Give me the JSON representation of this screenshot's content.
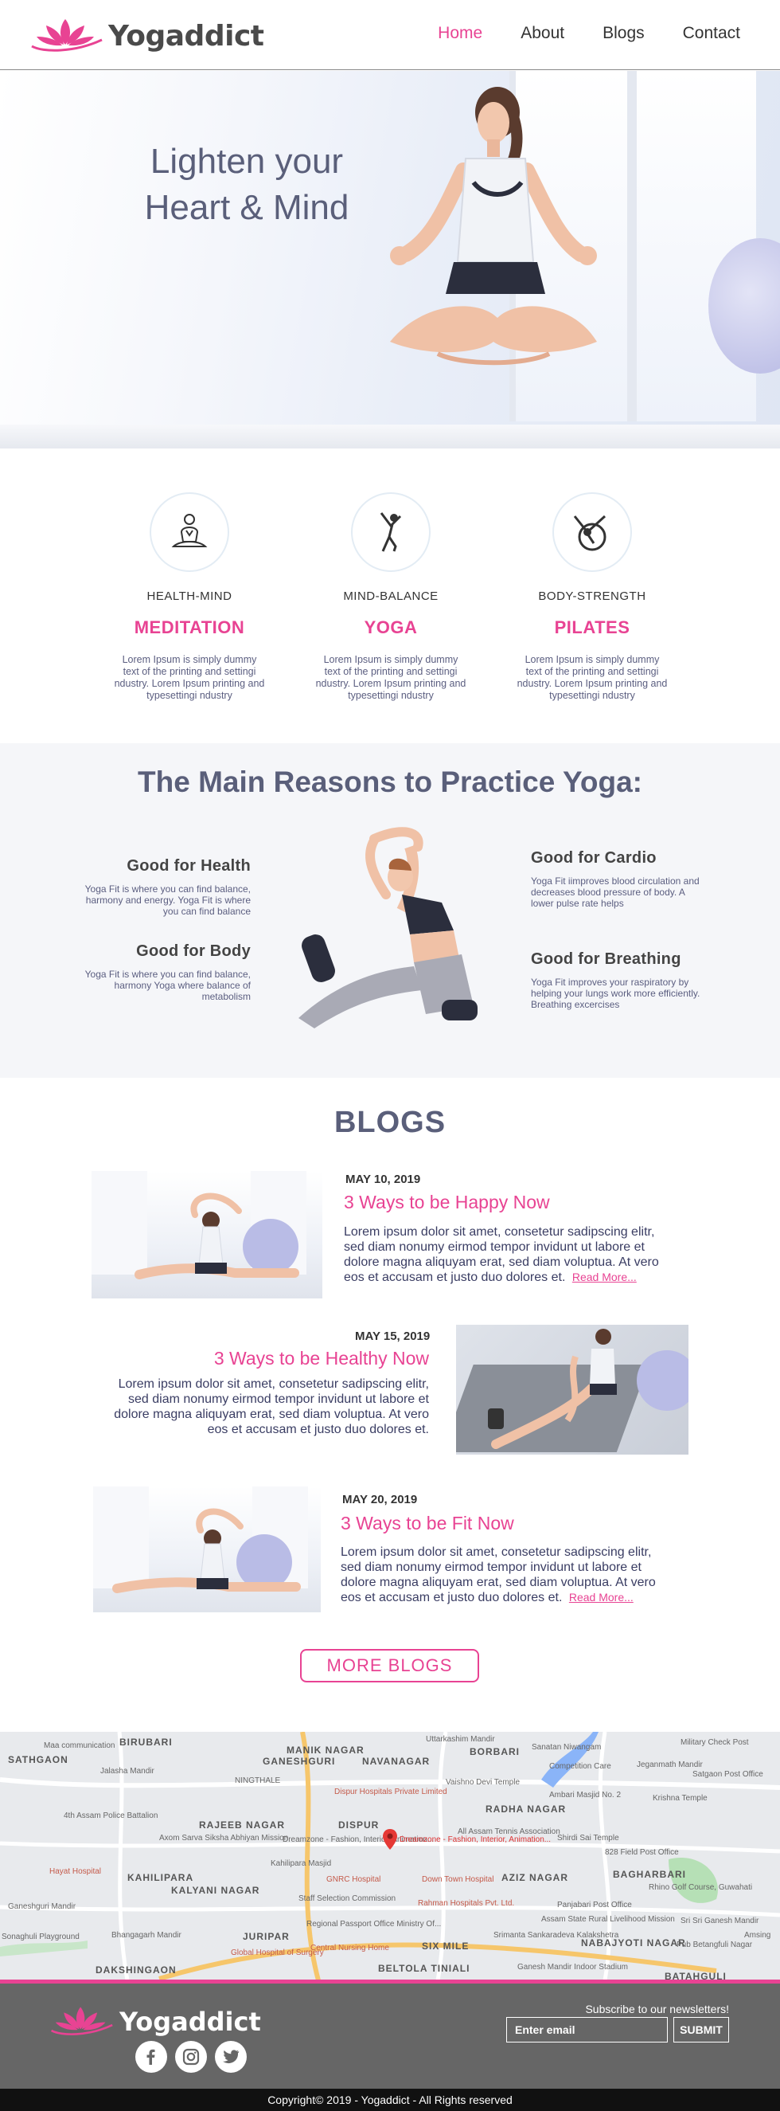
{
  "brand": {
    "name": "Yogaddict",
    "accent": "#e84393"
  },
  "nav": {
    "items": [
      "Home",
      "About",
      "Blogs",
      "Contact"
    ],
    "active": "Home"
  },
  "hero": {
    "line1": "Lighten your",
    "line2": "Heart & Mind"
  },
  "features": [
    {
      "icon": "meditation-icon",
      "sub": "HEALTH-MIND",
      "title": "MEDITATION",
      "desc": "Lorem Ipsum is simply dummy text of the printing and settingi ndustry. Lorem Ipsum printing and typesettingi ndustry"
    },
    {
      "icon": "yoga-pose-icon",
      "sub": "MIND-BALANCE",
      "title": "YOGA",
      "desc": "Lorem Ipsum is simply dummy text of the printing and settingi ndustry. Lorem Ipsum printing and typesettingi ndustry"
    },
    {
      "icon": "pilates-ring-icon",
      "sub": "BODY-STRENGTH",
      "title": "PILATES",
      "desc": "Lorem Ipsum is simply dummy text of the printing and settingi ndustry. Lorem Ipsum printing and typesettingi ndustry"
    }
  ],
  "reasons": {
    "title": "The Main Reasons to Practice Yoga:",
    "items": [
      {
        "heading": "Good for Health",
        "text": "Yoga Fit is where you can find balance, harmony and energy. Yoga Fit is where you can find balance"
      },
      {
        "heading": "Good for Body",
        "text": "Yoga Fit is where you can find balance, harmony Yoga where balance of metabolism"
      },
      {
        "heading": "Good for Cardio",
        "text": "Yoga Fit iimproves blood circulation and decreases blood pressure of body. A lower pulse rate helps"
      },
      {
        "heading": "Good for Breathing",
        "text": "Yoga Fit improves your raspiratory by helping your lungs work more efficiently. Breathing excercises"
      }
    ]
  },
  "blogs": {
    "title": "BLOGS",
    "posts": [
      {
        "date": "MAY 10, 2019",
        "title": "3 Ways to be Happy Now",
        "body": "Lorem ipsum dolor sit amet, consetetur sadipscing elitr, sed diam nonumy eirmod tempor invidunt ut labore et dolore magna aliquyam erat, sed diam voluptua. At vero eos et accusam et justo duo dolores et.",
        "more": "Read More..."
      },
      {
        "date": "MAY 15, 2019",
        "title": "3 Ways to be Healthy Now",
        "body": "Lorem ipsum dolor sit amet, consetetur sadipscing elitr, sed diam nonumy eirmod tempor invidunt ut labore et dolore magna aliquyam erat, sed diam voluptua. At vero eos et accusam et justo duo dolores et."
      },
      {
        "date": "MAY 20, 2019",
        "title": "3 Ways to be Fit Now",
        "body": "Lorem ipsum dolor sit amet, consetetur sadipscing elitr, sed diam nonumy eirmod tempor invidunt ut labore et dolore magna aliquyam erat, sed diam voluptua. At vero eos et accusam et justo duo dolores et.",
        "more": "Read More..."
      }
    ],
    "more_button": "MORE BLOGS"
  },
  "map": {
    "areas": [
      "BIRUBARI",
      "SATHGAON",
      "GANESHGURI",
      "NAVANAGAR",
      "BORBARI",
      "RAJEEB NAGAR",
      "DISPUR",
      "KAHILIPARA",
      "KALYANI NAGAR",
      "RADHA NAGAR",
      "AZIZ NAGAR",
      "BAGHARBARI",
      "JURIPAR",
      "SIX MILE",
      "NABAJYOTI NAGAR",
      "DAKSHINGAON",
      "BELTOLA TINIALI",
      "BATAHGULI",
      "MANIK NAGAR",
      "NINGTHALE"
    ],
    "pois": [
      "Maa communication",
      "Jalasha Mandir",
      "Uttarkashim Mandir",
      "Sanatan Niwangam",
      "Military Check Post",
      "Competition Care",
      "Jeganmath Mandir",
      "Satgaon Post Office",
      "Dispur Hospitals Private Limited",
      "Vaishno Devi Temple",
      "All Assam Tennis Association",
      "Ambari Masjid No. 2",
      "Krishna Temple",
      "4th Assam Police Battalion",
      "Dreamzone - Fashion, Interior, Animation...",
      "Shirdi Sai Temple",
      "Axom Sarva Siksha Abhiyan Mission",
      "Kahilipara Masjid",
      "828 Field Post Office",
      "Hayat Hospital",
      "GNRC Hospital",
      "Down Town Hospital",
      "Rhino Golf Course, Guwahati",
      "Staff Selection Commission",
      "Rahman Hospitals Pvt. Ltd.",
      "Panjabari Post Office",
      "Sonaghuli Playground",
      "Regional Passport Office Ministry Of...",
      "Central Nursing Home",
      "Srimanta Sankaradeva Kalakshetra",
      "Assam State Rural Livelihood Mission",
      "Global Hospital of Surgery",
      "Ganesh Mandir Indoor Stadium",
      "Pub Betangfuli Nagar",
      "Sri Sri Ganesh Mandir",
      "Ganeshguri Mandir",
      "Amsing",
      "Bhangagarh Mandir",
      "Rahman Hospitals",
      "Dreamzone - Fashion, Interior, Animation..."
    ]
  },
  "footer": {
    "brand": "Yogaddict",
    "newsletter_label": "Subscribe to our newsletters!",
    "email_placeholder": "Enter email",
    "submit": "SUBMIT",
    "socials": [
      "facebook-icon",
      "instagram-icon",
      "twitter-icon"
    ],
    "copyright": "Copyright© 2019 - Yogaddict - All Rights reserved"
  }
}
